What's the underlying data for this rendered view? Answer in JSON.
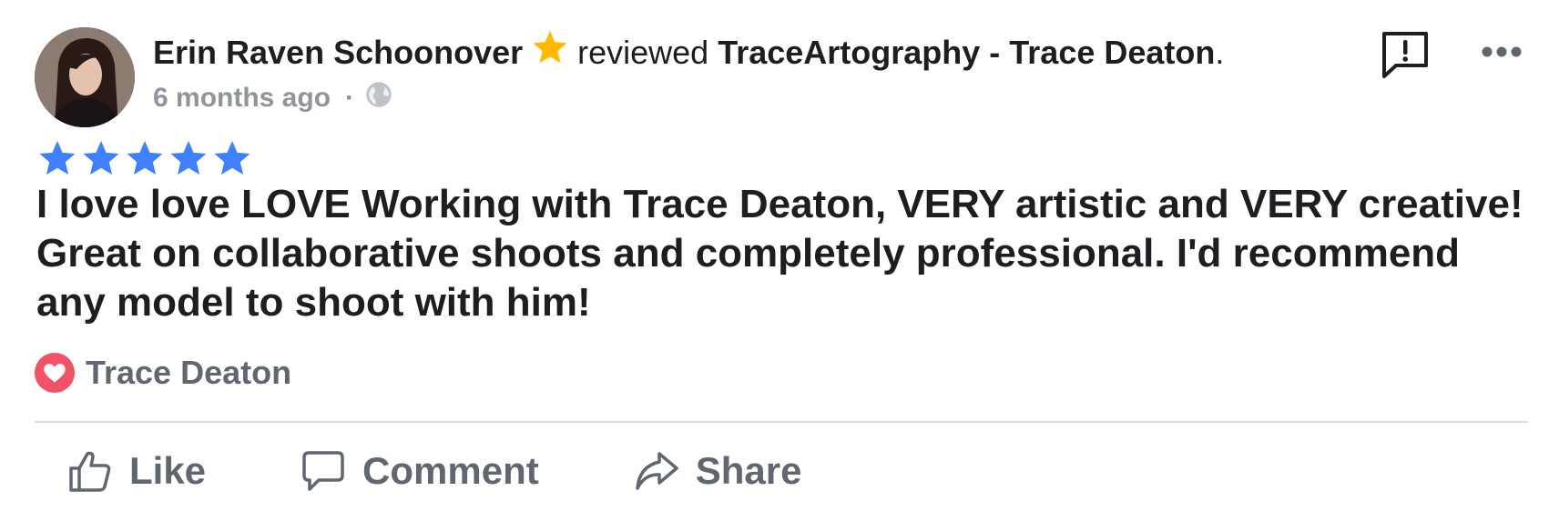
{
  "post": {
    "reviewer_name": "Erin Raven Schoonover",
    "action_text": "reviewed",
    "page_name": "TraceArtography - Trace Deaton",
    "period": ".",
    "timestamp": "6 months ago",
    "separator": "·",
    "privacy_icon": "globe-icon",
    "badge_icon": "star-icon",
    "rating_stars": 5,
    "review_text": "I love love LOVE Working with Trace Deaton, VERY artistic and VERY creative! Great on collaborative shoots and completely professional. I'd recommend any model to shoot with him!"
  },
  "reactions": {
    "icon": "heart-icon",
    "reactor_name": "Trace Deaton"
  },
  "actions": {
    "like_label": "Like",
    "comment_label": "Comment",
    "share_label": "Share"
  },
  "colors": {
    "rating_blue": "#4080ff",
    "badge_star_gold": "#ffba00",
    "love_red": "#f25268",
    "secondary_text": "#90949c",
    "action_gray": "#606770",
    "primary_text": "#1c1e21"
  }
}
